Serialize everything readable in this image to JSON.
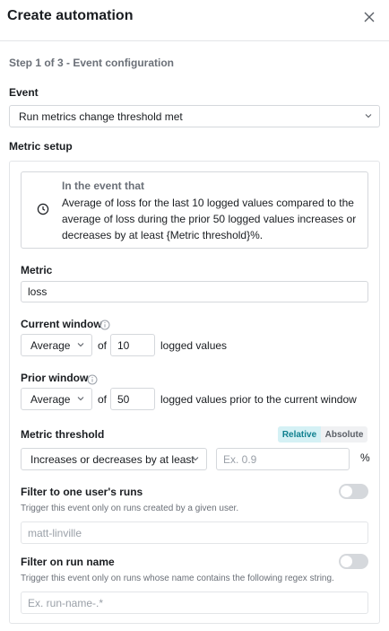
{
  "header": {
    "title": "Create automation"
  },
  "step": "Step 1 of 3 - Event configuration",
  "event": {
    "label": "Event",
    "value": "Run metrics change threshold met"
  },
  "metric_setup": {
    "label": "Metric setup",
    "event_head": "In the event that",
    "event_desc": "Average of loss for the last 10 logged values compared to the average of loss during the prior 50 logged values increases or decreases by at least {Metric threshold}%."
  },
  "metric": {
    "label": "Metric",
    "value": "loss"
  },
  "current_window": {
    "label": "Current window",
    "agg": "Average",
    "of": "of",
    "count": "10",
    "suffix": "logged values"
  },
  "prior_window": {
    "label": "Prior window",
    "agg": "Average",
    "of": "of",
    "count": "50",
    "suffix": "logged values prior to the current window"
  },
  "threshold": {
    "label": "Metric threshold",
    "mode_relative": "Relative",
    "mode_absolute": "Absolute",
    "condition": "Increases or decreases by at least",
    "placeholder": "Ex. 0.9",
    "unit": "%"
  },
  "filter_user": {
    "label": "Filter to one user's runs",
    "help": "Trigger this event only on runs created by a given user.",
    "value": "matt-linville"
  },
  "filter_name": {
    "label": "Filter on run name",
    "help": "Trigger this event only on runs whose name contains the following regex string.",
    "placeholder": "Ex. run-name-.*"
  }
}
